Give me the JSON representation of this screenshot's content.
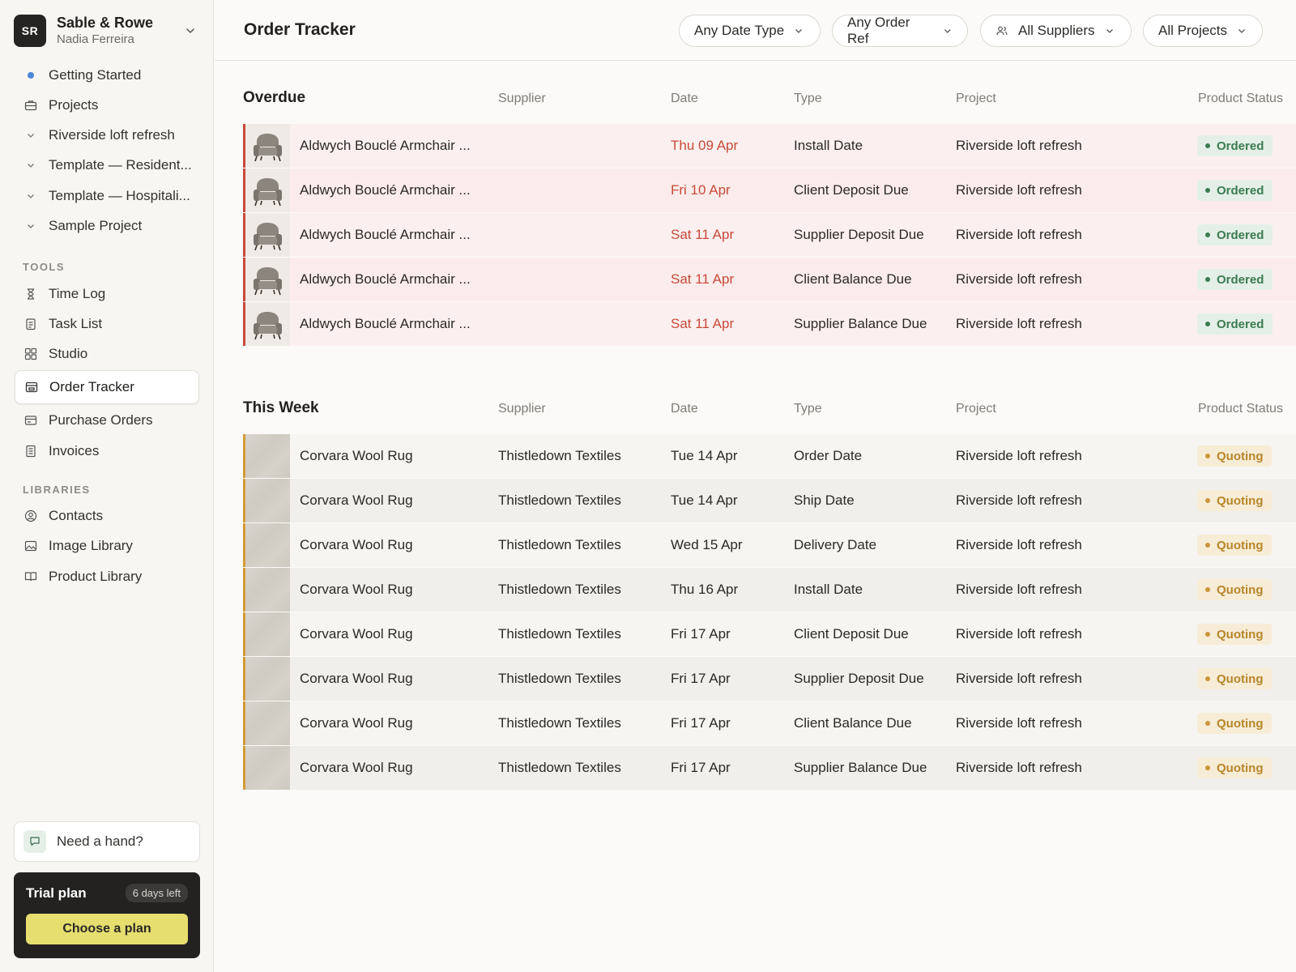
{
  "workspace": {
    "initials": "SR",
    "name": "Sable & Rowe",
    "user": "Nadia Ferreira"
  },
  "nav": {
    "top": [
      {
        "label": "Getting Started",
        "icon": "blue-dot-icon"
      },
      {
        "label": "Projects",
        "icon": "briefcase-icon"
      },
      {
        "label": "Riverside loft refresh",
        "icon": "chevron-down-icon"
      },
      {
        "label": "Template — Resident...",
        "icon": "chevron-down-icon"
      },
      {
        "label": "Template — Hospitali...",
        "icon": "chevron-down-icon"
      },
      {
        "label": "Sample Project",
        "icon": "chevron-down-icon"
      }
    ],
    "tools_label": "TOOLS",
    "tools": [
      {
        "label": "Time Log",
        "icon": "hourglass-icon"
      },
      {
        "label": "Task List",
        "icon": "clipboard-icon"
      },
      {
        "label": "Studio",
        "icon": "grid-icon"
      },
      {
        "label": "Order Tracker",
        "icon": "tracker-icon",
        "active": true
      },
      {
        "label": "Purchase Orders",
        "icon": "receipt-icon"
      },
      {
        "label": "Invoices",
        "icon": "invoice-icon"
      }
    ],
    "libraries_label": "LIBRARIES",
    "libraries": [
      {
        "label": "Contacts",
        "icon": "user-circle-icon"
      },
      {
        "label": "Image Library",
        "icon": "image-icon"
      },
      {
        "label": "Product Library",
        "icon": "book-icon"
      }
    ]
  },
  "help": {
    "label": "Need a hand?"
  },
  "trial": {
    "title": "Trial plan",
    "badge": "6 days left",
    "button": "Choose a plan"
  },
  "header": {
    "title": "Order Tracker",
    "filters": [
      "Any Date Type",
      "Any Order Ref",
      "All Suppliers",
      "All Projects"
    ]
  },
  "columns": {
    "supplier": "Supplier",
    "date": "Date",
    "type": "Type",
    "project": "Project",
    "status": "Product Status"
  },
  "overdue": {
    "title": "Overdue",
    "rows": [
      {
        "item": "Aldwych Bouclé Armchair ...",
        "supplier": "",
        "date": "Thu 09 Apr",
        "type": "Install Date",
        "project": "Riverside loft refresh",
        "status": "Ordered"
      },
      {
        "item": "Aldwych Bouclé Armchair ...",
        "supplier": "",
        "date": "Fri 10 Apr",
        "type": "Client Deposit Due",
        "project": "Riverside loft refresh",
        "status": "Ordered"
      },
      {
        "item": "Aldwych Bouclé Armchair ...",
        "supplier": "",
        "date": "Sat 11 Apr",
        "type": "Supplier Deposit Due",
        "project": "Riverside loft refresh",
        "status": "Ordered"
      },
      {
        "item": "Aldwych Bouclé Armchair ...",
        "supplier": "",
        "date": "Sat 11 Apr",
        "type": "Client Balance Due",
        "project": "Riverside loft refresh",
        "status": "Ordered"
      },
      {
        "item": "Aldwych Bouclé Armchair ...",
        "supplier": "",
        "date": "Sat 11 Apr",
        "type": "Supplier Balance Due",
        "project": "Riverside loft refresh",
        "status": "Ordered"
      }
    ]
  },
  "this_week": {
    "title": "This Week",
    "rows": [
      {
        "item": "Corvara Wool Rug",
        "supplier": "Thistledown Textiles",
        "date": "Tue 14 Apr",
        "type": "Order Date",
        "project": "Riverside loft refresh",
        "status": "Quoting"
      },
      {
        "item": "Corvara Wool Rug",
        "supplier": "Thistledown Textiles",
        "date": "Tue 14 Apr",
        "type": "Ship Date",
        "project": "Riverside loft refresh",
        "status": "Quoting"
      },
      {
        "item": "Corvara Wool Rug",
        "supplier": "Thistledown Textiles",
        "date": "Wed 15 Apr",
        "type": "Delivery Date",
        "project": "Riverside loft refresh",
        "status": "Quoting"
      },
      {
        "item": "Corvara Wool Rug",
        "supplier": "Thistledown Textiles",
        "date": "Thu 16 Apr",
        "type": "Install Date",
        "project": "Riverside loft refresh",
        "status": "Quoting"
      },
      {
        "item": "Corvara Wool Rug",
        "supplier": "Thistledown Textiles",
        "date": "Fri 17 Apr",
        "type": "Client Deposit Due",
        "project": "Riverside loft refresh",
        "status": "Quoting"
      },
      {
        "item": "Corvara Wool Rug",
        "supplier": "Thistledown Textiles",
        "date": "Fri 17 Apr",
        "type": "Supplier Deposit Due",
        "project": "Riverside loft refresh",
        "status": "Quoting"
      },
      {
        "item": "Corvara Wool Rug",
        "supplier": "Thistledown Textiles",
        "date": "Fri 17 Apr",
        "type": "Client Balance Due",
        "project": "Riverside loft refresh",
        "status": "Quoting"
      },
      {
        "item": "Corvara Wool Rug",
        "supplier": "Thistledown Textiles",
        "date": "Fri 17 Apr",
        "type": "Supplier Balance Due",
        "project": "Riverside loft refresh",
        "status": "Quoting"
      }
    ]
  },
  "colors": {
    "overdue": "#c8493a",
    "week": "#d39b36",
    "ordered": "#3c7a50",
    "quoting": "#b7862a"
  }
}
